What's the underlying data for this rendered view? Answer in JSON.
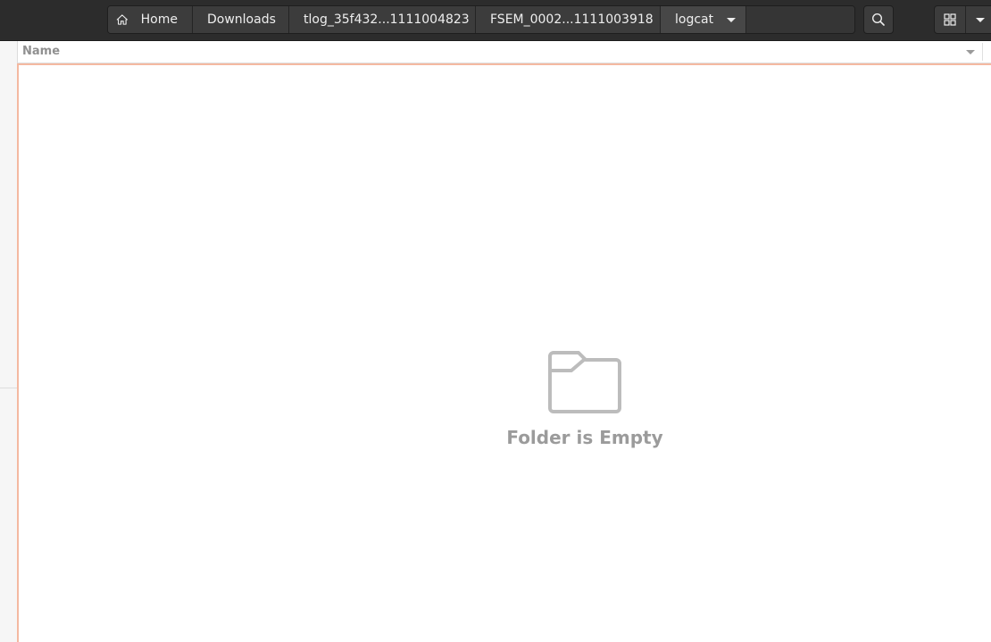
{
  "pathbar": {
    "crumbs": [
      {
        "label": "Home",
        "icon": "home-icon"
      },
      {
        "label": "Downloads"
      },
      {
        "label": "tlog_35f432...1111004823"
      },
      {
        "label": "FSEM_0002...1111003918"
      },
      {
        "label": "logcat",
        "has_dropdown": true
      }
    ]
  },
  "toolbar": {
    "search_icon": "search-icon",
    "view_icon": "grid-view-icon",
    "view_menu_icon": "chevron-down-icon"
  },
  "list": {
    "columns": [
      {
        "label": "Name",
        "sort_icon": "chevron-down-icon"
      }
    ]
  },
  "empty_state": {
    "icon": "folder-icon",
    "message": "Folder is Empty"
  },
  "colors": {
    "headerbar": "#2c2c2c",
    "focus_border": "#f4b9a1",
    "empty_text": "#9b9b9b"
  }
}
